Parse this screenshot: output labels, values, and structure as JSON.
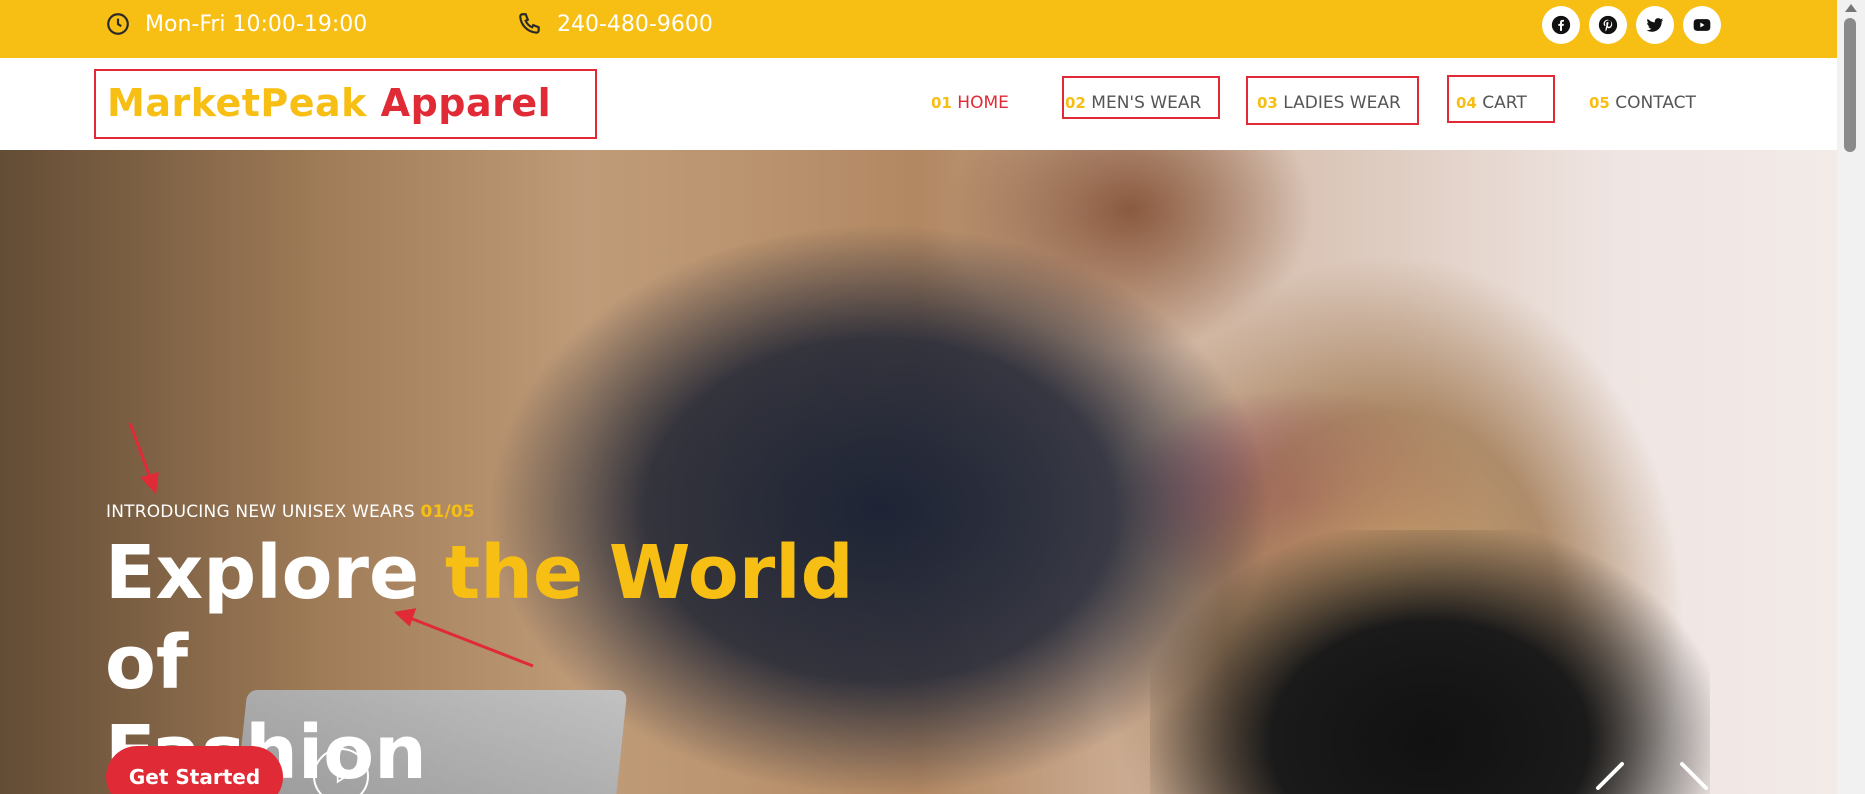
{
  "topbar": {
    "hours": "Mon-Fri 10:00-19:00",
    "phone": "240-480-9600",
    "social": [
      "facebook-icon",
      "pinterest-icon",
      "twitter-icon",
      "youtube-icon"
    ]
  },
  "brand": {
    "part1": "MarketPeak",
    "part2": "Apparel"
  },
  "nav": [
    {
      "num": "01",
      "label": "HOME",
      "active": true
    },
    {
      "num": "02",
      "label": "MEN'S WEAR",
      "active": false
    },
    {
      "num": "03",
      "label": "LADIES WEAR",
      "active": false
    },
    {
      "num": "04",
      "label": "CART",
      "active": false
    },
    {
      "num": "05",
      "label": "CONTACT",
      "active": false
    }
  ],
  "hero": {
    "intro": "INTRODUCING NEW UNISEX WEARS",
    "counter": "01/05",
    "headline_start": "Explore",
    "headline_highlight": "the World",
    "headline_end": "of",
    "headline_line2": "Fashion",
    "cta": "Get Started"
  },
  "colors": {
    "accent_yellow": "#f7be13",
    "accent_red": "#e02a35",
    "nav_text": "#555555"
  }
}
